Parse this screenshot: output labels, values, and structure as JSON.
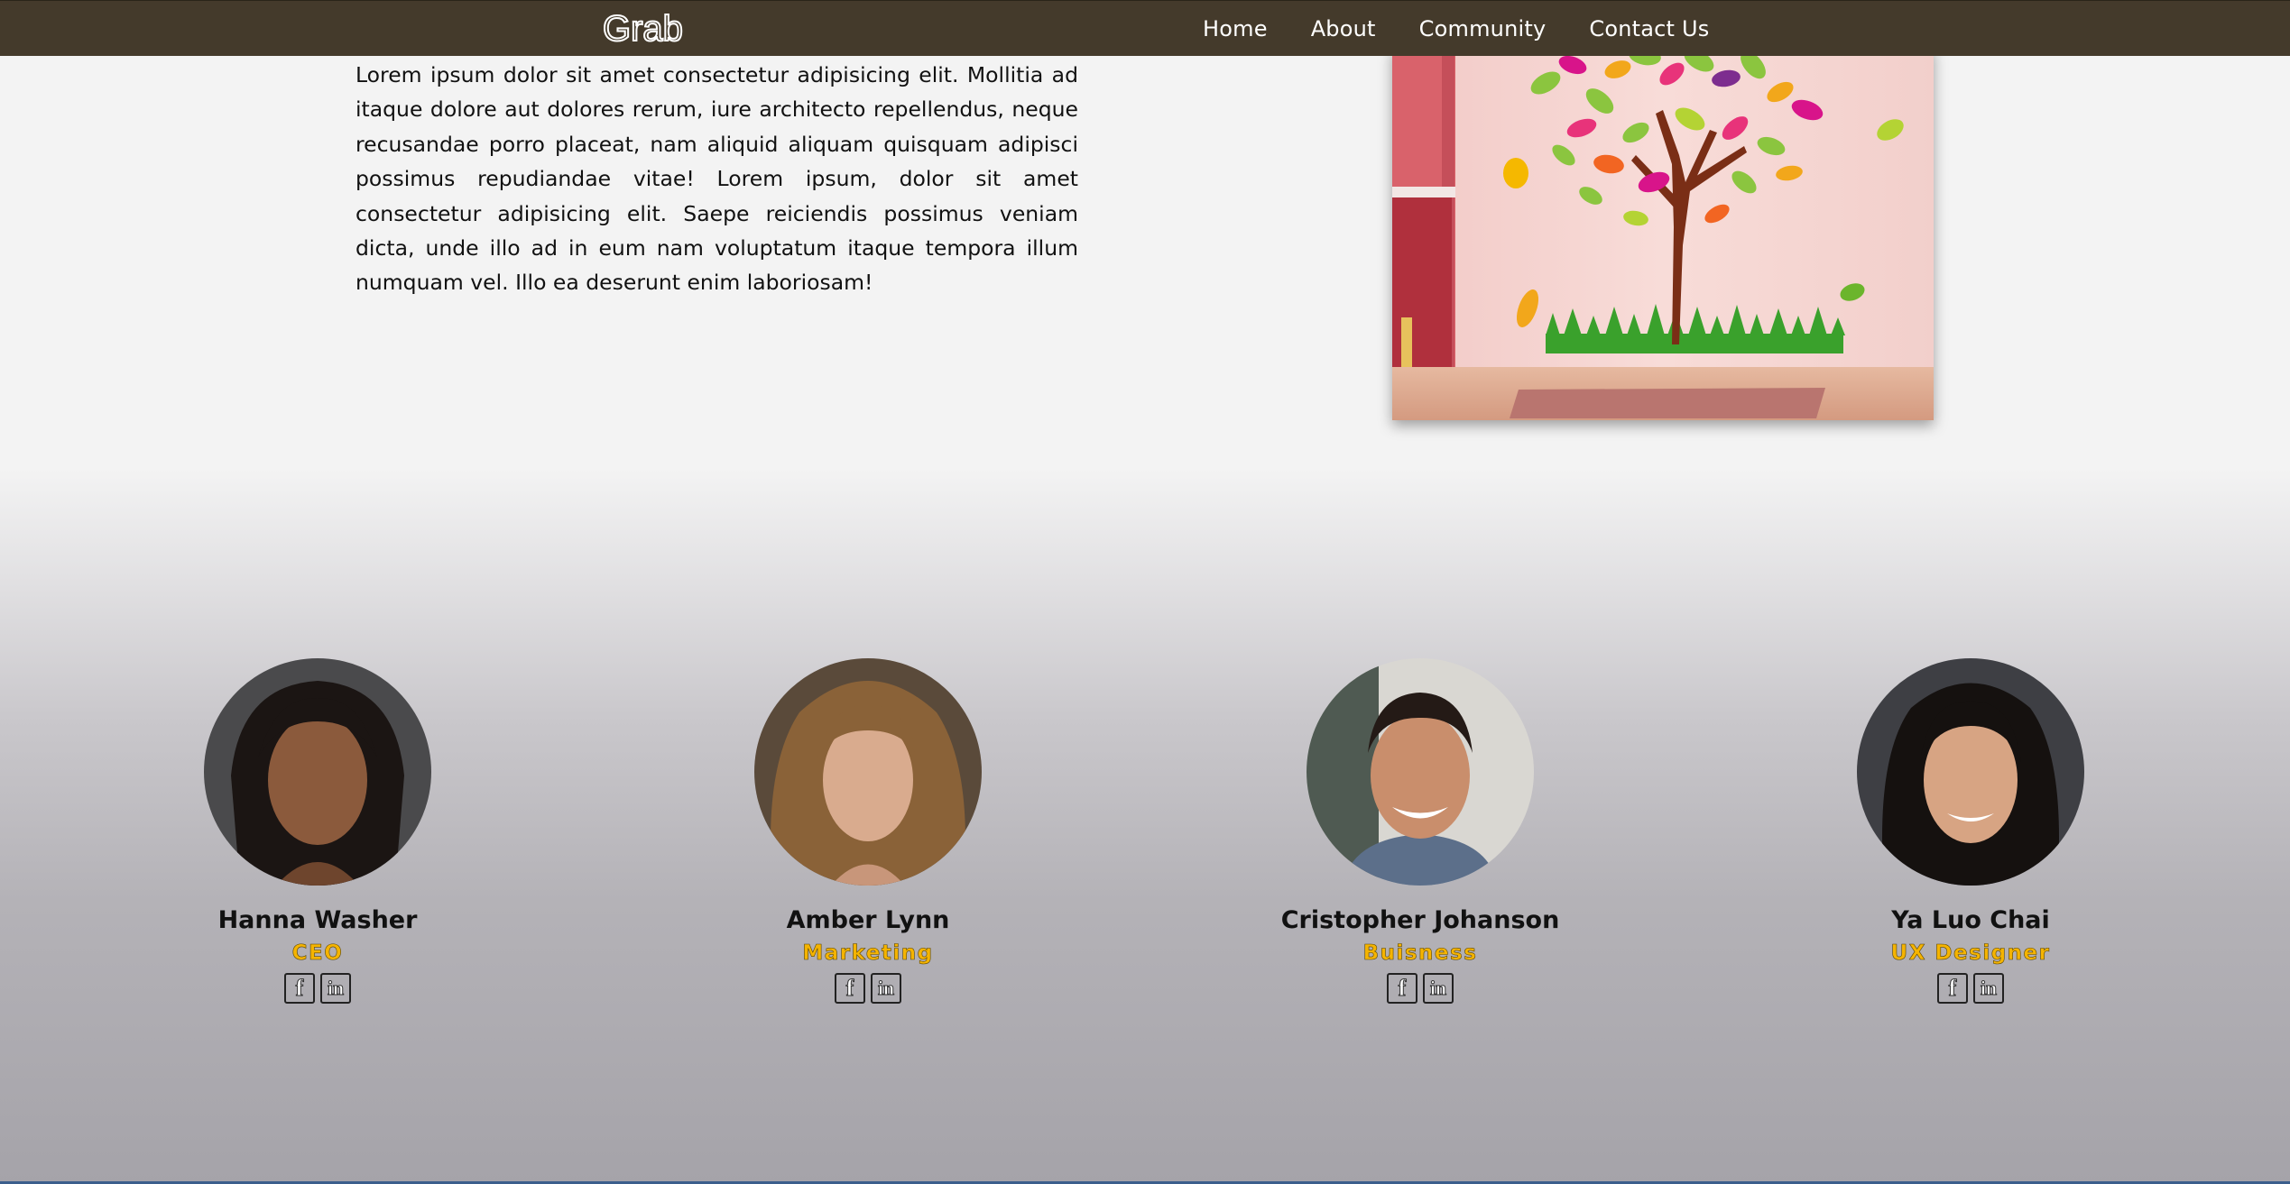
{
  "nav": {
    "logo": "Grab",
    "links": [
      "Home",
      "About",
      "Community",
      "Contact Us"
    ]
  },
  "intro": {
    "text": "Lorem ipsum dolor sit amet consectetur adipisicing elit. Mollitia ad itaque dolore aut dolores rerum, iure architecto repellendus, neque recusandae porro placeat, nam aliquid aliquam quisquam adipisci possimus repudiandae vitae! Lorem ipsum, dolor sit amet consectetur adipisicing elit. Saepe reiciendis possimus veniam dicta, unde illo ad in eum nam voluptatum itaque tempora illum numquam vel. Illo ea deserunt enim laboriosam!"
  },
  "team": [
    {
      "name": "Hanna Washer",
      "role": "CEO"
    },
    {
      "name": "Amber Lynn",
      "role": "Marketing"
    },
    {
      "name": "Cristopher Johanson",
      "role": "Buisness"
    },
    {
      "name": "Ya Luo Chai",
      "role": "UX Designer"
    }
  ],
  "social_icons": {
    "facebook": "f",
    "linkedin": "in"
  },
  "colors": {
    "navbar": "#443a2b",
    "role_accent": "#f5b400"
  }
}
